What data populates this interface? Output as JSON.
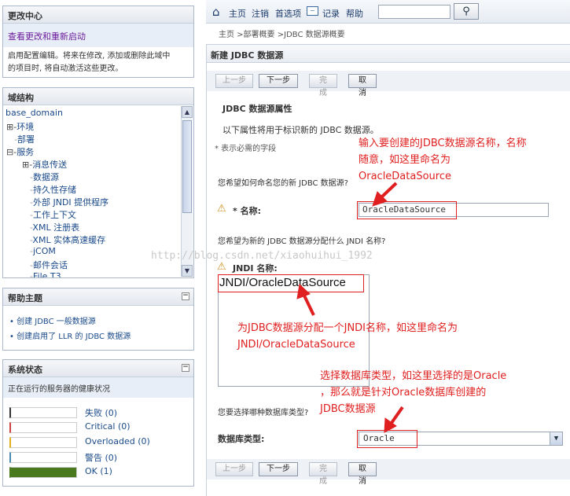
{
  "left": {
    "change_center": {
      "title": "更改中心",
      "link": "查看更改和重新启动",
      "desc_line1": "启用配置编辑。将来在修改, 添加或删除此域中",
      "desc_line2": "的项目时, 将自动激活这些更改。"
    },
    "domain_structure": {
      "title": "域结构",
      "root": "base_domain",
      "items": [
        "环境",
        "部署",
        "服务",
        "消息传送",
        "数据源",
        "持久性存储",
        "外部 JNDI 提供程序",
        "工作上下文",
        "XML 注册表",
        "XML 实体高速缓存",
        "jCOM",
        "邮件会话",
        "File T3"
      ]
    },
    "help": {
      "title": "帮助主题",
      "links": [
        "创建 JDBC 一般数据源",
        "创建启用了 LLR 的 JDBC 数据源"
      ]
    },
    "system_status": {
      "title": "系统状态",
      "subtitle": "正在运行的服务器的健康状况",
      "rows": [
        {
          "label": "失败 (0)",
          "color": "#333333",
          "fraction": 0
        },
        {
          "label": "Critical (0)",
          "color": "#d04040",
          "fraction": 0
        },
        {
          "label": "Overloaded (0)",
          "color": "#e0b020",
          "fraction": 0
        },
        {
          "label": "警告 (0)",
          "color": "#4a8ab0",
          "fraction": 0
        },
        {
          "label": "OK (1)",
          "color": "#4a7a1e",
          "fraction": 1
        }
      ]
    }
  },
  "topbar": {
    "home": "主页",
    "logout": "注销",
    "prefs": "首选项",
    "record": "记录",
    "help": "帮助",
    "search_placeholder": ""
  },
  "breadcrumb": "主页 >部署概要 >JDBC 数据源概要",
  "page_title": "新建 JDBC 数据源",
  "buttons": {
    "prev": "上一步",
    "next": "下一步",
    "finish": "完成",
    "cancel": "取消"
  },
  "section": {
    "title": "JDBC 数据源属性",
    "desc": "以下属性将用于标识新的 JDBC 数据源。",
    "required_note": "* 表示必需的字段"
  },
  "q_name": "您希望如何命名您的新 JDBC 数据源?",
  "name_label": "* 名称:",
  "name_value": "OracleDataSource",
  "q_jndi": "您希望为新的 JDBC 数据源分配什么 JNDI 名称?",
  "jndi_label": "JNDI 名称:",
  "jndi_value": "JNDI/OracleDataSource",
  "q_db": "您要选择哪种数据库类型?",
  "db_label": "数据库类型:",
  "db_value": "Oracle",
  "watermark": "http://blog.csdn.net/xiaohuihui_1992",
  "annotations": {
    "a1_l1": "输入要创建的JDBC数据源名称，名称",
    "a1_l2": "随意，如这里命名为",
    "a1_l3": "OracleDataSource",
    "a2_l1": "为JDBC数据源分配一个JNDI名称，如这里命名为",
    "a2_l2": "JNDI/OracleDataSource",
    "a3_l1": "选择数据库类型，如这里选择的是Oracle",
    "a3_l2": "，那么就是针对Oracle数据库创建的",
    "a3_l3": "JDBC数据源"
  }
}
